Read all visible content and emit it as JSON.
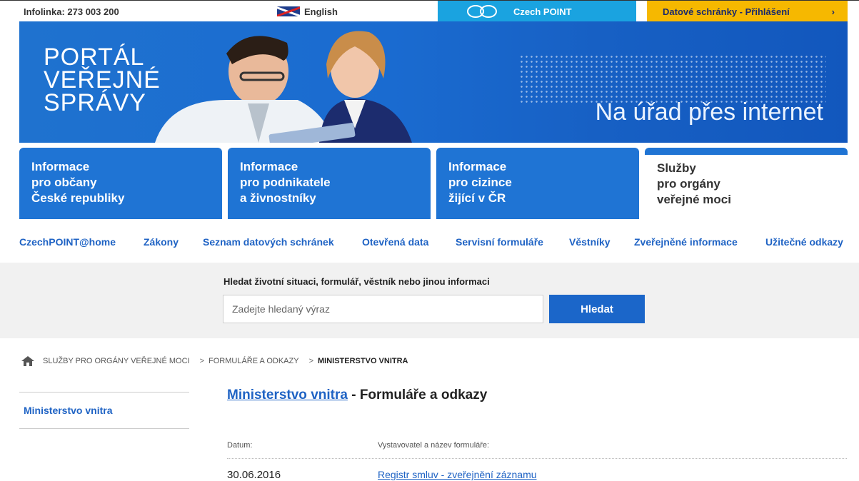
{
  "topbar": {
    "info": "Infolinka: 273 003 200",
    "language": "English",
    "czechpoint": "Czech POINT",
    "datove_schranky": "Datové schránky - Přihlášení",
    "ds_arrow": "›"
  },
  "banner": {
    "title_lines": [
      "PORTÁL",
      "VEŘEJNÉ",
      "SPRÁVY"
    ],
    "tagline": "Na úřad přes internet"
  },
  "tabs": [
    {
      "lines": [
        "Informace",
        "pro občany",
        "České republiky"
      ],
      "active": false
    },
    {
      "lines": [
        "Informace",
        "pro podnikatele",
        "a živnostníky"
      ],
      "active": false
    },
    {
      "lines": [
        "Informace",
        "pro cizince",
        "žijící v ČR"
      ],
      "active": false
    },
    {
      "lines": [
        "Služby",
        "pro orgány",
        "veřejné moci"
      ],
      "active": true
    }
  ],
  "subnav": [
    "CzechPOINT@home",
    "Zákony",
    "Seznam datových schránek",
    "Otevřená data",
    "Servisní formuláře",
    "Věstníky",
    "Zveřejněné informace",
    "Užitečné odkazy"
  ],
  "search": {
    "label": "Hledat životní situaci, formulář, věstník nebo jinou informaci",
    "placeholder": "Zadejte hledaný výraz",
    "button": "Hledat"
  },
  "breadcrumb": {
    "items": [
      "SLUŽBY PRO ORGÁNY VEŘEJNÉ MOCI",
      "FORMULÁŘE A ODKAZY",
      "MINISTERSTVO VNITRA"
    ],
    "separator": ">"
  },
  "sidebar": {
    "item": "Ministerstvo vnitra"
  },
  "main": {
    "title_link": "Ministerstvo vnitra",
    "title_rest": " - Formuláře a odkazy",
    "col_date": "Datum:",
    "col_name": "Vystavovatel a název formuláře:",
    "rows": [
      {
        "date": "30.06.2016",
        "name": "Registr smluv - zveřejnění záznamu"
      }
    ]
  },
  "colors": {
    "brand_blue": "#1f74d4",
    "link_blue": "#1f63c4",
    "czechpoint_cyan": "#1aa3e0",
    "datove_yellow": "#f6b800"
  },
  "icons": [
    "flag-uk-icon",
    "czechpoint-logo-icon",
    "home-icon"
  ]
}
